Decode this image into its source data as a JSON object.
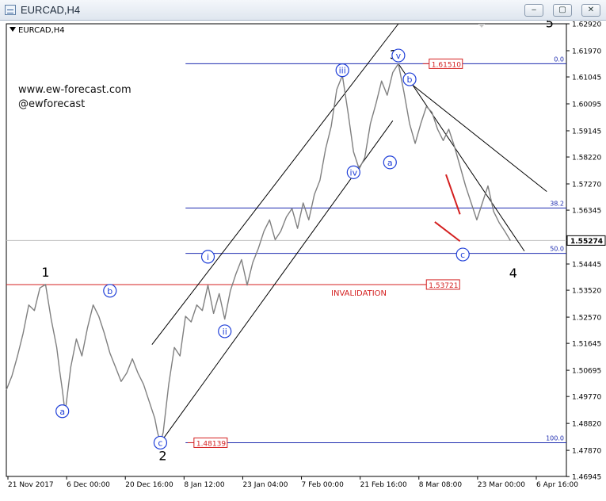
{
  "window": {
    "title": "EURCAD,H4",
    "buttons": [
      {
        "name": "minimize",
        "glyph": "‒"
      },
      {
        "name": "maximize",
        "glyph": "▢"
      },
      {
        "name": "close",
        "glyph": "✕"
      }
    ]
  },
  "chart_data": {
    "type": "line",
    "symbol_label": "EURCAD,H4",
    "watermark": [
      "www.ew-forecast.com",
      "@ewforecast"
    ],
    "colors": {
      "price": "#808080",
      "level_line": "#1e2cb0",
      "invalidation": "#d42020",
      "wave_circle": "#1f3fd8",
      "channel": "#000000"
    },
    "y_axis": {
      "ylim": [
        1.4695,
        1.6292
      ],
      "ticks": [
        "1.62920",
        "1.61970",
        "1.61045",
        "1.60095",
        "1.59145",
        "1.58220",
        "1.57270",
        "1.56345",
        "1.55274",
        "1.54445",
        "1.53520",
        "1.52570",
        "1.51645",
        "1.50695",
        "1.49770",
        "1.48820",
        "1.47870",
        "1.46945"
      ],
      "current_price": "1.55274"
    },
    "x_axis": {
      "ticks": [
        "21 Nov 2017",
        "6 Dec 00:00",
        "20 Dec 16:00",
        "8 Jan 12:00",
        "23 Jan 04:00",
        "7 Feb 00:00",
        "21 Feb 16:00",
        "8 Mar 08:00",
        "23 Mar 00:00",
        "6 Apr 16:00"
      ]
    },
    "price_path": [
      [
        0,
        1.5
      ],
      [
        2,
        1.505
      ],
      [
        4,
        1.512
      ],
      [
        6,
        1.52
      ],
      [
        8,
        1.53
      ],
      [
        10,
        1.528
      ],
      [
        12,
        1.536
      ],
      [
        14,
        1.5372
      ],
      [
        16,
        1.525
      ],
      [
        18,
        1.515
      ],
      [
        19,
        1.507
      ],
      [
        20,
        1.5
      ],
      [
        21,
        1.492
      ],
      [
        23,
        1.508
      ],
      [
        25,
        1.518
      ],
      [
        27,
        1.512
      ],
      [
        29,
        1.522
      ],
      [
        31,
        1.53
      ],
      [
        33,
        1.526
      ],
      [
        35,
        1.52
      ],
      [
        37,
        1.513
      ],
      [
        39,
        1.508
      ],
      [
        41,
        1.503
      ],
      [
        43,
        1.506
      ],
      [
        45,
        1.511
      ],
      [
        47,
        1.506
      ],
      [
        49,
        1.502
      ],
      [
        51,
        1.496
      ],
      [
        53,
        1.49
      ],
      [
        54,
        1.485
      ],
      [
        55,
        1.4814
      ],
      [
        56,
        1.485
      ],
      [
        58,
        1.502
      ],
      [
        60,
        1.515
      ],
      [
        62,
        1.512
      ],
      [
        64,
        1.526
      ],
      [
        66,
        1.524
      ],
      [
        68,
        1.53
      ],
      [
        70,
        1.528
      ],
      [
        72,
        1.537
      ],
      [
        74,
        1.527
      ],
      [
        76,
        1.534
      ],
      [
        78,
        1.525
      ],
      [
        80,
        1.535
      ],
      [
        82,
        1.541
      ],
      [
        84,
        1.546
      ],
      [
        86,
        1.537
      ],
      [
        88,
        1.545
      ],
      [
        90,
        1.55
      ],
      [
        92,
        1.556
      ],
      [
        94,
        1.56
      ],
      [
        96,
        1.553
      ],
      [
        98,
        1.556
      ],
      [
        100,
        1.561
      ],
      [
        102,
        1.564
      ],
      [
        104,
        1.557
      ],
      [
        106,
        1.566
      ],
      [
        108,
        1.56
      ],
      [
        110,
        1.569
      ],
      [
        112,
        1.574
      ],
      [
        114,
        1.585
      ],
      [
        116,
        1.593
      ],
      [
        118,
        1.606
      ],
      [
        120,
        1.611
      ],
      [
        122,
        1.598
      ],
      [
        124,
        1.584
      ],
      [
        126,
        1.578
      ],
      [
        128,
        1.582
      ],
      [
        130,
        1.594
      ],
      [
        132,
        1.601
      ],
      [
        134,
        1.609
      ],
      [
        136,
        1.604
      ],
      [
        138,
        1.612
      ],
      [
        140,
        1.6151
      ],
      [
        142,
        1.605
      ],
      [
        144,
        1.594
      ],
      [
        146,
        1.587
      ],
      [
        148,
        1.594
      ],
      [
        150,
        1.6
      ],
      [
        152,
        1.598
      ],
      [
        154,
        1.592
      ],
      [
        156,
        1.588
      ],
      [
        158,
        1.592
      ],
      [
        160,
        1.586
      ],
      [
        162,
        1.579
      ],
      [
        164,
        1.572
      ],
      [
        166,
        1.566
      ],
      [
        168,
        1.56
      ],
      [
        170,
        1.566
      ],
      [
        172,
        1.572
      ],
      [
        174,
        1.563
      ],
      [
        176,
        1.559
      ],
      [
        178,
        1.556
      ],
      [
        180,
        1.5527
      ]
    ],
    "horizontal_levels": [
      {
        "kind": "fib",
        "label": "0.0",
        "value": 1.6151
      },
      {
        "kind": "fib",
        "label": "38.2",
        "value": 1.5642
      },
      {
        "kind": "fib",
        "label": "50.0",
        "value": 1.5482
      },
      {
        "kind": "fib",
        "label": "100.0",
        "value": 1.4814
      },
      {
        "kind": "invalidation",
        "label": "INVALIDATION",
        "value": 1.5372
      }
    ],
    "price_tags": [
      "1.61510",
      "1.53721",
      "1.48139"
    ],
    "wave_labels": {
      "major": [
        {
          "label": "1",
          "t": 14,
          "v": 1.5372
        },
        {
          "label": "2",
          "t": 55,
          "v": 1.4814
        },
        {
          "label": "3",
          "t": 140,
          "v": 1.6151
        },
        {
          "label": "4",
          "t": 181,
          "v": 1.547
        },
        {
          "label": "5",
          "t": 194,
          "v": 1.628
        }
      ],
      "circled": [
        {
          "label": "a",
          "t": 20,
          "v": 1.4925
        },
        {
          "label": "b",
          "t": 37,
          "v": 1.535
        },
        {
          "label": "c",
          "t": 55,
          "v": 1.4814
        },
        {
          "label": "i",
          "t": 72,
          "v": 1.547
        },
        {
          "label": "ii",
          "t": 78,
          "v": 1.5207
        },
        {
          "label": "iii",
          "t": 120,
          "v": 1.6128
        },
        {
          "label": "iv",
          "t": 124,
          "v": 1.5768
        },
        {
          "label": "v",
          "t": 140,
          "v": 1.618
        },
        {
          "label": "b",
          "t": 144,
          "v": 1.6096
        },
        {
          "label": "a",
          "t": 137,
          "v": 1.5803
        },
        {
          "label": "c",
          "t": 163,
          "v": 1.5478
        }
      ]
    },
    "trendlines": [
      {
        "kind": "channel",
        "from": [
          52,
          1.516
        ],
        "to": [
          140,
          1.6292
        ]
      },
      {
        "kind": "channel",
        "from": [
          55,
          1.4814
        ],
        "to": [
          138,
          1.595
        ]
      },
      {
        "kind": "channel",
        "from": [
          140,
          1.6151
        ],
        "to": [
          185,
          1.549
        ]
      },
      {
        "kind": "channel",
        "from": [
          142,
          1.61
        ],
        "to": [
          193,
          1.57
        ]
      },
      {
        "kind": "wedge",
        "from": [
          157,
          1.576
        ],
        "to": [
          162,
          1.562
        ]
      },
      {
        "kind": "wedge",
        "from": [
          153,
          1.5593
        ],
        "to": [
          162,
          1.5525
        ]
      }
    ]
  }
}
